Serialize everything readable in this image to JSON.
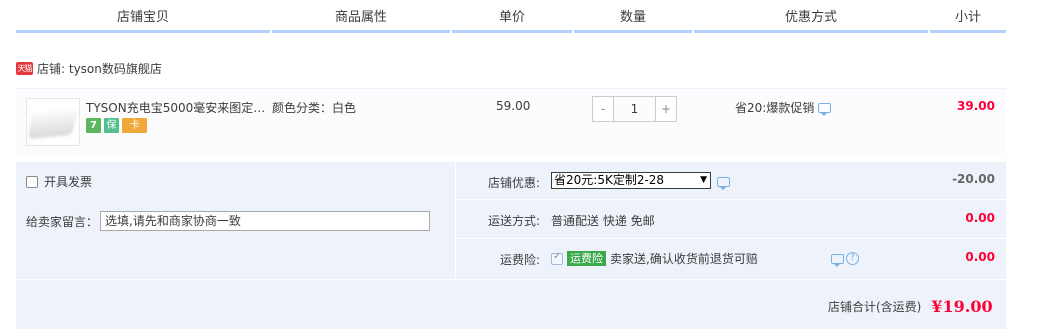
{
  "header": {
    "columns": [
      "店铺宝贝",
      "商品属性",
      "单价",
      "数量",
      "优惠方式",
      "小计"
    ]
  },
  "shop": {
    "logo_text": "天猫",
    "label": "店铺: tyson数码旗舰店"
  },
  "item": {
    "title": "TYSON充电宝5000毫安来图定…",
    "badges": [
      "7",
      "保",
      "卡"
    ],
    "attribute": "颜色分类：白色",
    "unit_price": "59.00",
    "quantity": {
      "minus": "-",
      "value": "1",
      "plus": "+"
    },
    "promotion": "省20:爆款促销",
    "subtotal": "39.00"
  },
  "invoice": {
    "label": "开具发票"
  },
  "note": {
    "label": "给卖家留言：",
    "placeholder": "选填,请先和商家协商一致"
  },
  "shop_discount": {
    "label": "店铺优惠:",
    "selected": "省20元:5K定制2-28",
    "amount": "-20.00"
  },
  "shipping": {
    "label": "运送方式:",
    "value": "普通配送 快递 免邮",
    "amount": "0.00"
  },
  "insurance": {
    "label": "运费险:",
    "badge": "运费险",
    "text": "卖家送,确认收货前退货可赔",
    "amount": "0.00"
  },
  "total": {
    "label": "店铺合计(含运费)",
    "value": "¥19.00"
  },
  "colors": {
    "accent_red": "#ff0036",
    "header_border": "#b2d1ff",
    "section_bg": "#eef3fb"
  }
}
